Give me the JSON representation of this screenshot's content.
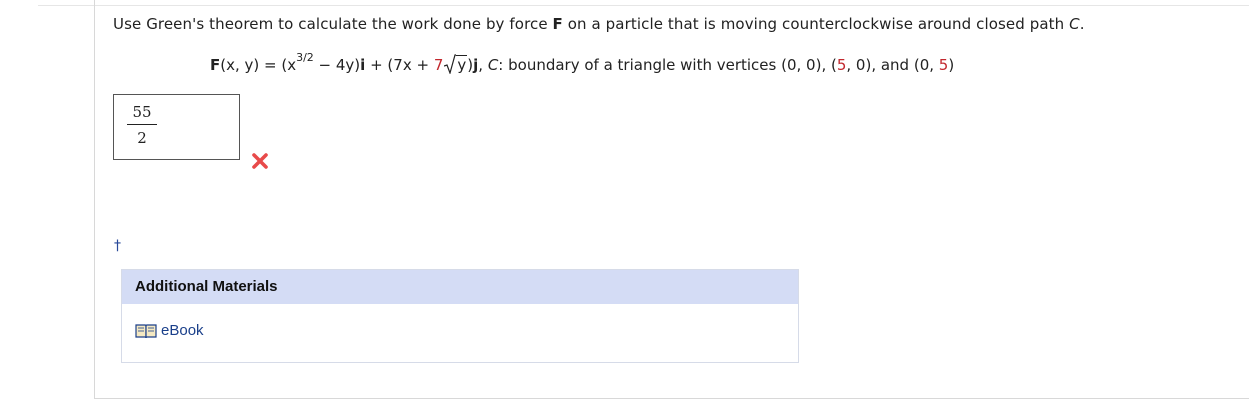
{
  "question": {
    "pre": "Use Green's theorem to calculate the work done by force ",
    "force_symbol": "F",
    "mid": " on a particle that is moving counterclockwise around closed path ",
    "path_symbol": "C",
    "end": "."
  },
  "equation": {
    "lhs_F": "F",
    "lhs_args": "(x, y) = (x",
    "exp": "3/2",
    "t1": " − 4y)",
    "i": "i",
    "t2": " + (7x + ",
    "coef": "7",
    "radicand": "y",
    "t3": ")",
    "j": "j",
    "t4": ", ",
    "C": "C",
    "t5": ": boundary of a triangle with vertices (0, 0), (",
    "v1": "5",
    "t6": ", 0), and (0, ",
    "v2": "5",
    "t7": ")"
  },
  "answer": {
    "numerator": "55",
    "denominator": "2",
    "status": "incorrect"
  },
  "dagger": "†",
  "materials": {
    "header": "Additional Materials",
    "ebook_label": "eBook"
  },
  "colors": {
    "accent_red": "#c2272d",
    "header_bg": "#d4dcf5",
    "link": "#1a3f8a",
    "wrong": "#e84a4a"
  },
  "icons": {
    "wrong": "x-mark-icon",
    "ebook": "open-book-icon"
  }
}
